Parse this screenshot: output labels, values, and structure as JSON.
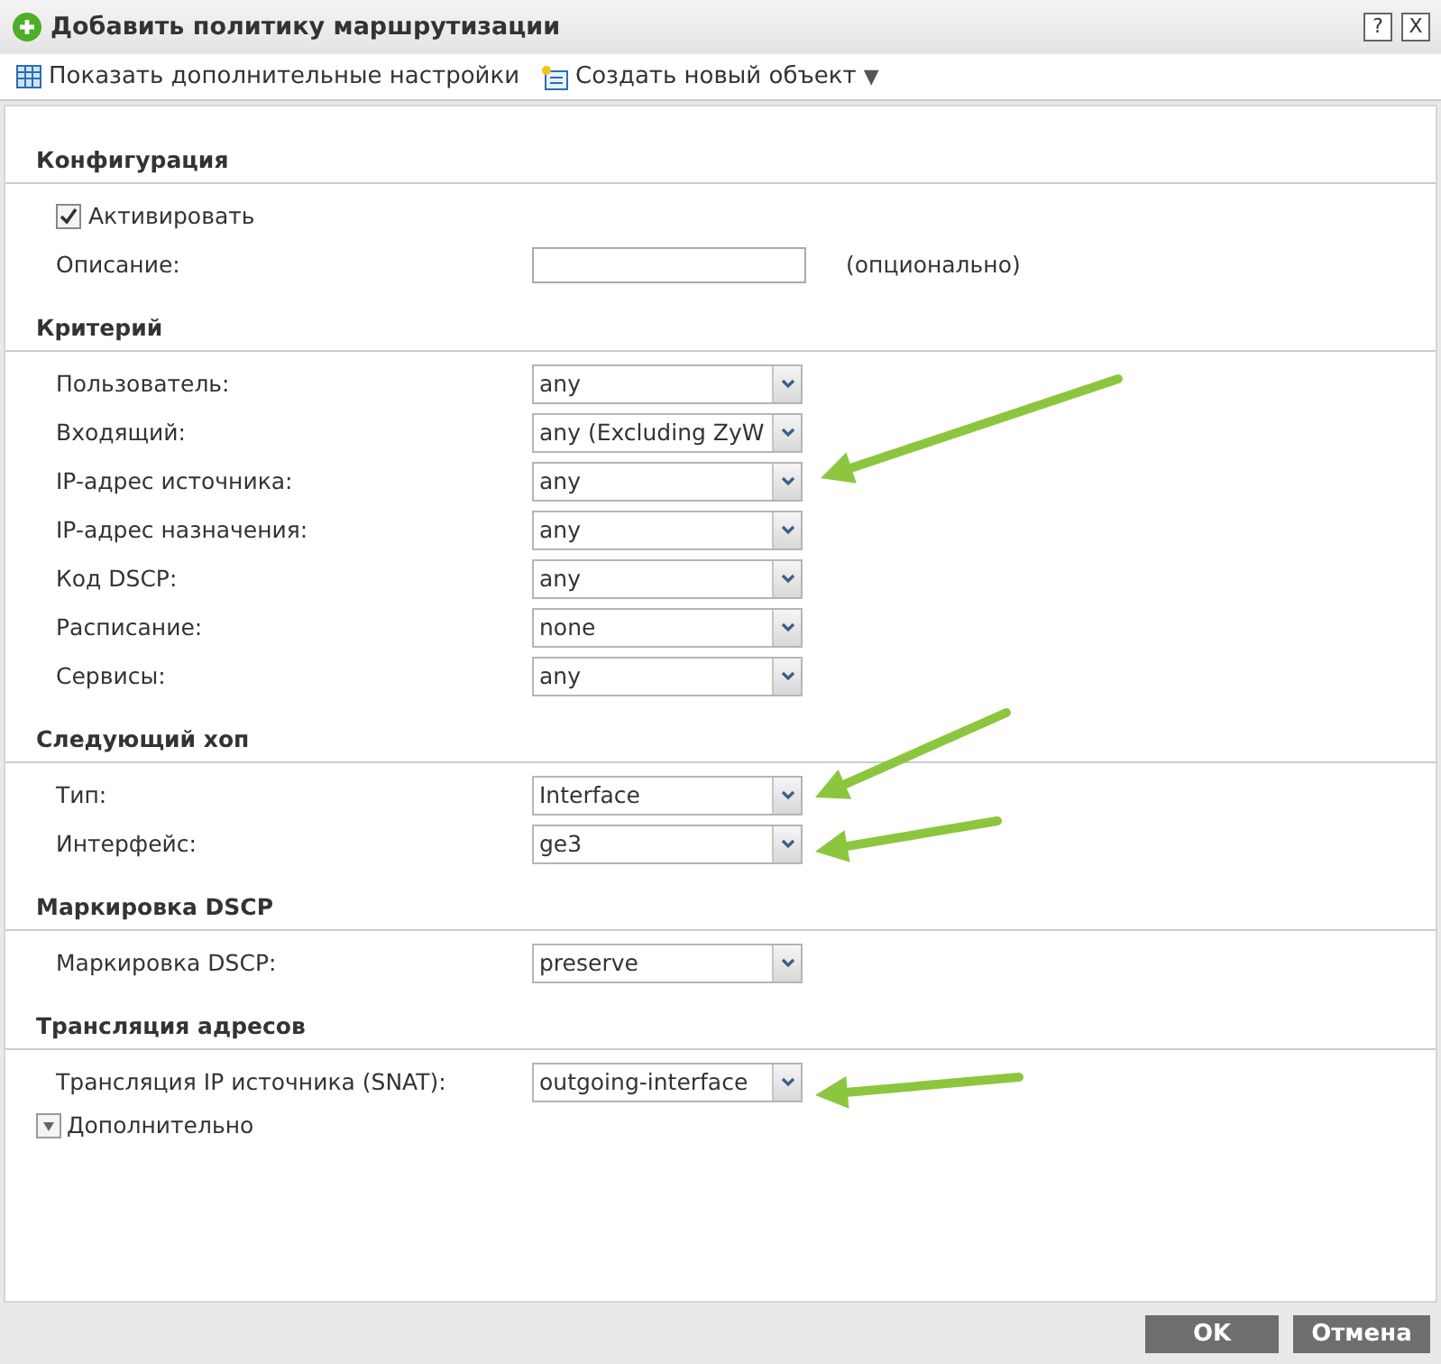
{
  "window": {
    "title": "Добавить политику маршрутизации",
    "help": "?",
    "close": "X"
  },
  "toolbar": [
    {
      "label": "Показать дополнительные настройки",
      "kind": "table"
    },
    {
      "label": "Создать новый объект",
      "kind": "new",
      "dropdown": "▼"
    }
  ],
  "sections": [
    {
      "title": "Конфигурация",
      "rows": [
        {
          "kind": "checkbox",
          "label": "Активировать",
          "checked": true
        },
        {
          "kind": "text",
          "label": "Описание:",
          "note": "(опционально)"
        }
      ]
    },
    {
      "title": "Критерий",
      "rows": [
        {
          "kind": "select",
          "label": "Пользователь:",
          "value": "any"
        },
        {
          "kind": "select",
          "label": "Входящий:",
          "value": "any (Excluding ZyW"
        },
        {
          "kind": "select",
          "label": "IP-адрес источника:",
          "value": "any"
        },
        {
          "kind": "select",
          "label": "IP-адрес назначения:",
          "value": "any"
        },
        {
          "kind": "select",
          "label": "Код DSCP:",
          "value": "any"
        },
        {
          "kind": "select",
          "label": "Расписание:",
          "value": "none"
        },
        {
          "kind": "select",
          "label": "Сервисы:",
          "value": "any"
        }
      ]
    },
    {
      "title": "Следующий хоп",
      "rows": [
        {
          "kind": "select",
          "label": "Тип:",
          "value": "Interface"
        },
        {
          "kind": "select",
          "label": "Интерфейс:",
          "value": "ge3"
        }
      ]
    },
    {
      "title": "Маркировка DSCP",
      "rows": [
        {
          "kind": "select",
          "label": "Маркировка DSCP:",
          "value": "preserve"
        }
      ]
    },
    {
      "title": "Трансляция адресов",
      "rows": [
        {
          "kind": "select",
          "label": "Трансляция IP источника (SNAT):",
          "value": "outgoing-interface"
        }
      ]
    }
  ],
  "advanced": {
    "label": "Дополнительно",
    "expanded": false
  },
  "buttons": [
    "OK",
    "Отмена"
  ]
}
